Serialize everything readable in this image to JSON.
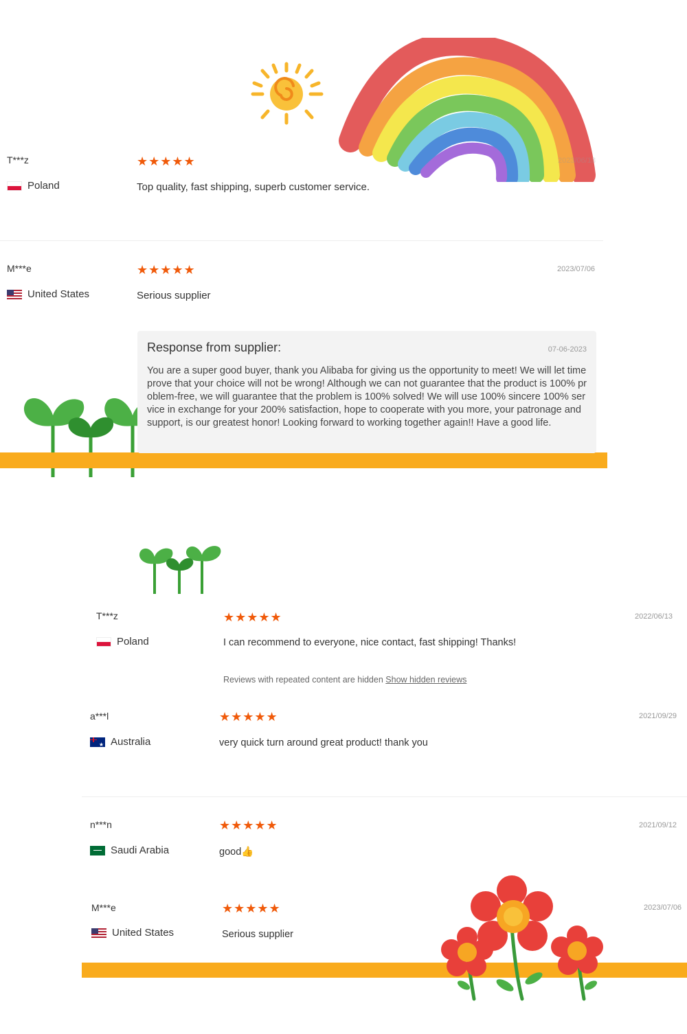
{
  "reviews_top": [
    {
      "name": "T***z",
      "country": "Poland",
      "flag": "pl",
      "stars": "★★★★★",
      "text": "Top quality, fast shipping, superb customer service.",
      "date": "2023/06/18"
    },
    {
      "name": "M***e",
      "country": "United States",
      "flag": "us",
      "stars": "★★★★★",
      "text": "Serious supplier",
      "date": "2023/07/06"
    }
  ],
  "response": {
    "title": "Response from supplier:",
    "date": "07-06-2023",
    "body": "You are a super good buyer, thank you Alibaba for giving us the opportunity to meet! We will let time prove that your choice will not be wrong! Although we can not guarantee that the product is 100% problem-free, we will guarantee that the problem is 100% solved! We will use 100% sincere 100% service in exchange for your 200% satisfaction, hope to cooperate with you more, your patronage and support, is our greatest honor! Looking forward to working together again!! Have a good life."
  },
  "reviews_bottom": [
    {
      "name": "T***z",
      "country": "Poland",
      "flag": "pl",
      "stars": "★★★★★",
      "text": "I can recommend to everyone, nice contact, fast shipping! Thanks!",
      "date": "2022/06/13"
    },
    {
      "name": "a***l",
      "country": "Australia",
      "flag": "au",
      "stars": "★★★★★",
      "text": "very quick turn around great product! thank you",
      "date": "2021/09/29"
    },
    {
      "name": "n***n",
      "country": "Saudi Arabia",
      "flag": "sa",
      "stars": "★★★★★",
      "text": "good👍",
      "date": "2021/09/12"
    },
    {
      "name": "M***e",
      "country": "United States",
      "flag": "us",
      "stars": "★★★★★",
      "text": "Serious supplier",
      "date": "2023/07/06"
    }
  ],
  "hidden": {
    "note": "Reviews with repeated content are hidden",
    "link": "Show hidden reviews"
  },
  "colors": {
    "star": "#f05a0a",
    "band": "#f9ab1d",
    "response_bg": "#f3f3f3"
  },
  "decorations": [
    "sun",
    "rainbow",
    "sprouts",
    "sprouts-small",
    "flowers"
  ]
}
